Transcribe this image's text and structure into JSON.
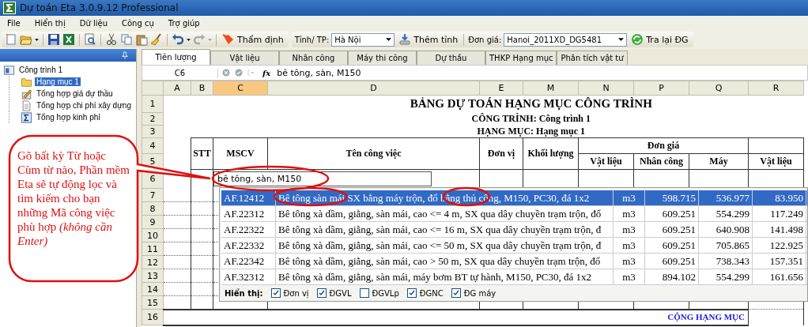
{
  "window": {
    "title": "Dự toán Eta 3.0.9.12 Professional"
  },
  "menu": [
    "File",
    "Hiển thị",
    "Dữ liệu",
    "Công cụ",
    "Trợ giúp"
  ],
  "toolbar": {
    "review_button": "Thẩm định",
    "province_label": "Tỉnh/ TP:",
    "province_value": "Hà Nội",
    "add_province_button": "Thêm tỉnh",
    "price_label": "Đơn giá:",
    "price_value": "Hanoi_2011XD_DG5481",
    "lookup_button": "Tra lại ĐG"
  },
  "sidebar": {
    "tree": [
      {
        "label": "Công trình 1",
        "kind": "project",
        "selected": false,
        "children": [
          {
            "label": "Hạng mục 1",
            "kind": "folder",
            "selected": true
          },
          {
            "label": "Tổng hợp giá dự thầu",
            "kind": "bid",
            "selected": false
          },
          {
            "label": "Tổng hợp chi phí xây dựng",
            "kind": "doc",
            "selected": false
          },
          {
            "label": "Tổng hợp kinh phí",
            "kind": "sum",
            "selected": false
          }
        ]
      }
    ]
  },
  "tabs": [
    {
      "label": "Tiên lượng",
      "selected": true
    },
    {
      "label": "Vật liệu",
      "selected": false
    },
    {
      "label": "Nhân công",
      "selected": false
    },
    {
      "label": "Máy thi công",
      "selected": false
    },
    {
      "label": "Dự thầu",
      "selected": false
    },
    {
      "label": "THKP Hạng mục",
      "selected": false
    },
    {
      "label": "Phân tích vật tư",
      "selected": false
    }
  ],
  "formula_bar": {
    "cell_ref": "C6",
    "function_label": "fx",
    "value": "bê tông, sàn, M150"
  },
  "columns": [
    {
      "label": "A",
      "selected": false
    },
    {
      "label": "B",
      "selected": false
    },
    {
      "label": "C",
      "selected": true
    },
    {
      "label": "D",
      "selected": false
    },
    {
      "label": "E",
      "selected": false
    },
    {
      "label": "M",
      "selected": false
    },
    {
      "label": "N",
      "selected": false
    },
    {
      "label": "P",
      "selected": false
    },
    {
      "label": "Q",
      "selected": false
    },
    {
      "label": "R",
      "selected": false
    }
  ],
  "row_numbers": [
    "1",
    "2",
    "3",
    "4",
    "5",
    "6",
    "7",
    "8",
    "9",
    "10",
    "11",
    "12",
    "13",
    "14",
    "15",
    "16"
  ],
  "sheet": {
    "title": "BẢNG DỰ TOÁN HẠNG MỤC CÔNG TRÌNH",
    "project_line": "CÔNG TRÌNH: Công trình 1",
    "item_line": "HẠNG MỤC: Hạng mục 1",
    "headers": {
      "stt": "STT",
      "code": "MSCV",
      "name": "Tên công việc",
      "unit": "Đơn vị",
      "quantity": "Khối lượng",
      "unit_price": "Đơn giá",
      "material": "Vật liệu",
      "labor": "Nhân công",
      "machine": "Máy",
      "material_2": "Vật liệu"
    },
    "input_value": "bê tông, sàn, M150",
    "total_label": "CỘNG HẠNG MỤC"
  },
  "suggestions": {
    "rows": [
      {
        "code": "AF.12412",
        "name": "Bê tông sàn mái SX bằng máy trộn, đổ bằng thủ công, M150, PC30, đá 1x2",
        "unit": "m3",
        "material": "598.715",
        "labor": "536.977",
        "machine": "83.950",
        "selected": true
      },
      {
        "code": "AF.22312",
        "name": "Bê tông xà dầm, giằng, sàn mái, cao <= 4 m, SX qua dây chuyền trạm trộn, đổ",
        "unit": "m3",
        "material": "609.251",
        "labor": "554.299",
        "machine": "117.249",
        "selected": false
      },
      {
        "code": "AF.22322",
        "name": "Bê tông xà dầm, giằng, sàn mái, cao <= 16 m, SX qua dây chuyền trạm trộn, đ",
        "unit": "m3",
        "material": "609.251",
        "labor": "640.908",
        "machine": "141.498",
        "selected": false
      },
      {
        "code": "AF.22332",
        "name": "Bê tông xà dầm, giằng, sàn mái, cao <= 50 m, SX qua dây chuyền trạm trộn, đ",
        "unit": "m3",
        "material": "609.251",
        "labor": "705.865",
        "machine": "122.925",
        "selected": false
      },
      {
        "code": "AF.22342",
        "name": "Bê tông xà dầm, giằng, sàn mái, cao > 50 m, SX qua dây chuyền trạm trộn, đổ",
        "unit": "m3",
        "material": "609.251",
        "labor": "738.343",
        "machine": "157.351",
        "selected": false
      },
      {
        "code": "AF.32312",
        "name": "Bê tông xà dầm, giằng, sàn mái, máy bơm BT tự hành, M150, PC30, đá 1x2",
        "unit": "m3",
        "material": "894.102",
        "labor": "554.299",
        "machine": "161.656",
        "selected": false
      }
    ],
    "show_label": "Hiển thị:",
    "options": [
      {
        "label": "Đơn vị",
        "checked": true
      },
      {
        "label": "ĐGVL",
        "checked": true
      },
      {
        "label": "ĐGVLp",
        "checked": false
      },
      {
        "label": "ĐGNC",
        "checked": true
      },
      {
        "label": "ĐG máy",
        "checked": true
      }
    ]
  },
  "callout": {
    "text": "Gõ bất kỳ Từ hoặc Cùm từ nào, Phần mềm Eta sẽ tự động lọc và tìm kiếm cho bạn những Mã công việc phù hợp *(không cần Enter)*"
  }
}
